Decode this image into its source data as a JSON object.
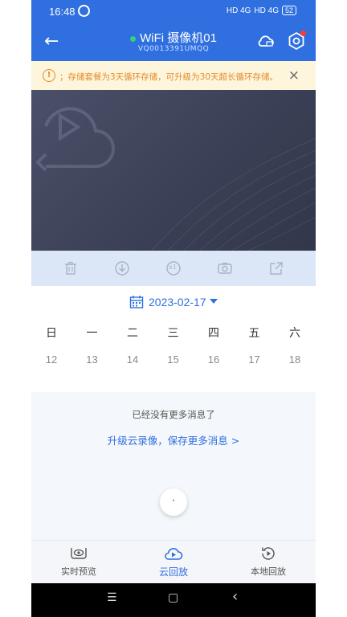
{
  "status_bar": {
    "time": "16:48",
    "network": "HD 4G",
    "signal": "HD 4G",
    "battery": "52"
  },
  "header": {
    "title": "WiFi 摄像机01",
    "device_id": "VQ0013391UMQQ",
    "online_color": "#36d07a"
  },
  "notice": {
    "text": "；存储套餐为3天循环存储，可升级为30天超长循环存储。",
    "close": "×"
  },
  "toolbar": {
    "icons": [
      "trash-icon",
      "download-icon",
      "speed-x1-icon",
      "camera-icon",
      "share-icon"
    ],
    "speed_label": "x1"
  },
  "calendar": {
    "date": "2023-02-17",
    "weekdays": [
      "日",
      "一",
      "二",
      "三",
      "四",
      "五",
      "六"
    ],
    "days": [
      "12",
      "13",
      "14",
      "15",
      "16",
      "17",
      "18"
    ]
  },
  "messages": {
    "empty_text": "已经没有更多消息了",
    "upgrade_link": "升级云录像，保存更多消息 >",
    "float_button": "·"
  },
  "tabs": [
    {
      "label": "实时预览",
      "icon": "eye-icon"
    },
    {
      "label": "云回放",
      "icon": "cloud-play-icon"
    },
    {
      "label": "本地回放",
      "icon": "replay-icon"
    }
  ],
  "navbar": {
    "menu": "☰",
    "home": "▢",
    "back": "‹"
  },
  "colors": {
    "accent": "#2f6fe0",
    "notice_bg": "#fdf6dc",
    "notice_text": "#e38a2a"
  }
}
